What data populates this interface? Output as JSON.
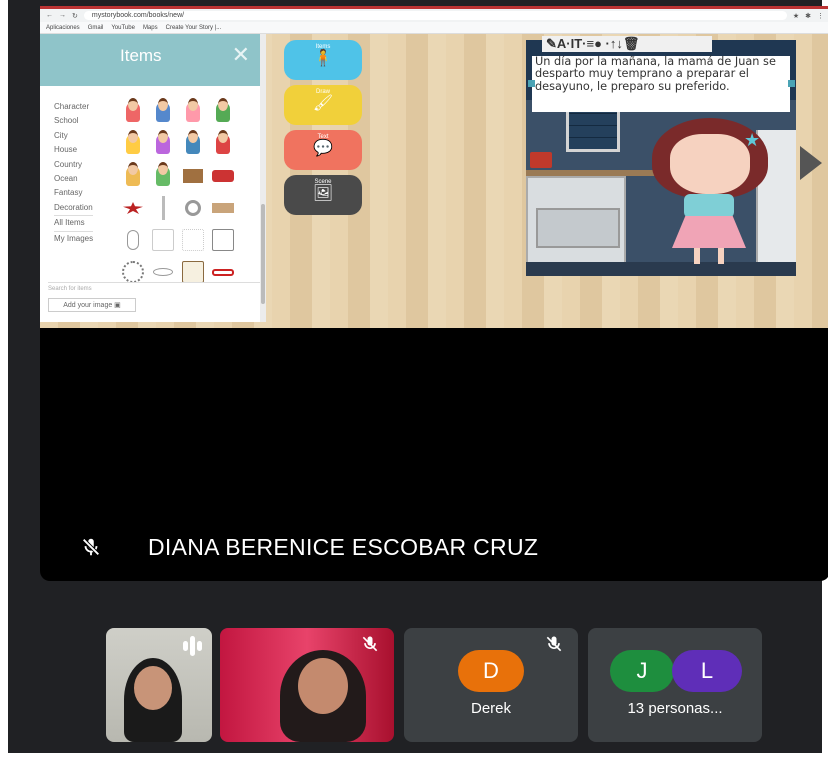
{
  "browser": {
    "url": "mystorybook.com/books/new/",
    "bookmarks": [
      "Aplicaciones",
      "Gmail",
      "YouTube",
      "Maps",
      "Create Your Story |..."
    ]
  },
  "items_panel": {
    "title": "Items",
    "close": "✕",
    "categories": [
      "Character",
      "School",
      "City",
      "House",
      "Country",
      "Ocean",
      "Fantasy",
      "Decoration",
      "All Items",
      "My Images"
    ],
    "search_placeholder": "Search for items",
    "add_image_label": "Add your image"
  },
  "tools": [
    {
      "label": "Items",
      "glyph": "🧍",
      "color": "#4fc3e8",
      "icon": "person-icon"
    },
    {
      "label": "Draw",
      "glyph": "🖌",
      "color": "#f1d03a",
      "icon": "brush-icon"
    },
    {
      "label": "Text",
      "glyph": "💬",
      "color": "#f0735f",
      "icon": "speech-icon"
    },
    {
      "label": "Scene",
      "glyph": "🖼",
      "color": "#4a4a4a",
      "icon": "image-icon"
    }
  ],
  "editor_toolbar": "✎A·IT·≡● ·↑↓🗑",
  "story_text": "Un día por la mañana, la mamá de Juan se desparto muy temprano a preparar el desayuno, le preparo su preferido.",
  "presenter": {
    "name": "DIANA BERENICE ESCOBAR CRUZ"
  },
  "participants": [
    {
      "name": "Derek",
      "initial": "D",
      "color": "#e8710a"
    },
    {
      "name": "13 personas...",
      "initials": [
        "J",
        "L"
      ],
      "colors": [
        "#1e8e3e",
        "#5f2eb8"
      ]
    }
  ]
}
